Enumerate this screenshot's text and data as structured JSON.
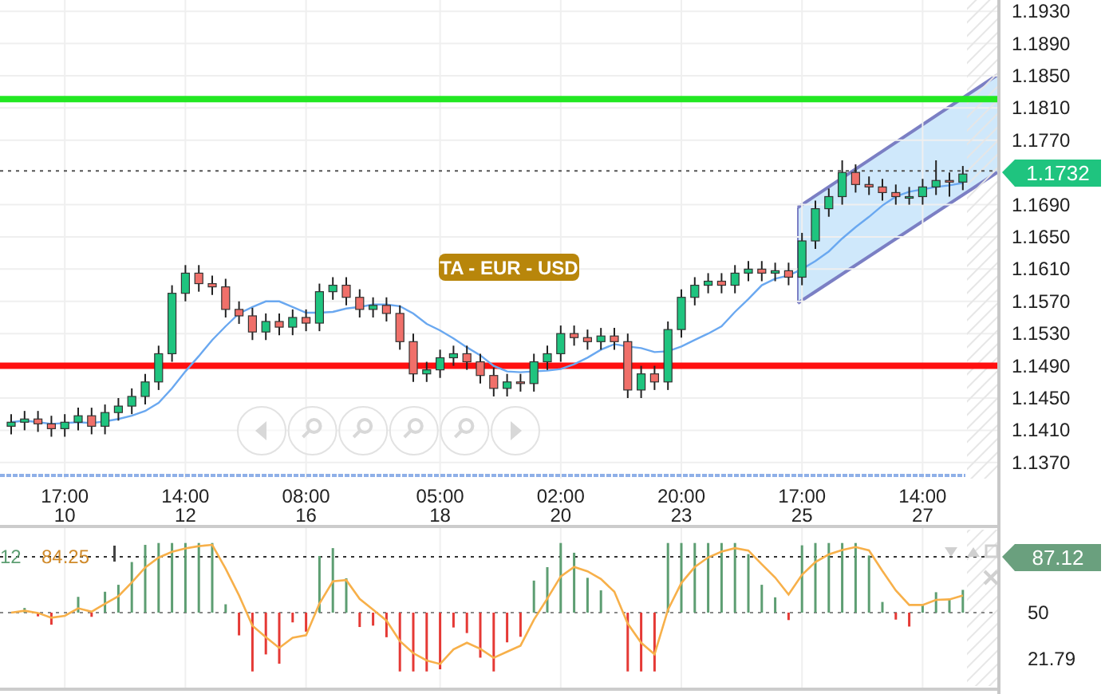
{
  "price_chart": {
    "badge": "TA - EUR - USD",
    "current_price": "1.1732",
    "dates": [
      "10",
      "12",
      "16",
      "18",
      "20",
      "23",
      "25",
      "27"
    ],
    "chart_data": {
      "type": "candlestick",
      "grid": true,
      "ylim": [
        1.135,
        1.1944
      ],
      "categories": [
        null,
        null,
        null,
        null,
        "17:00",
        null,
        null,
        null,
        null,
        null,
        null,
        null,
        null,
        "14:00",
        null,
        null,
        null,
        null,
        null,
        null,
        null,
        null,
        "08:00",
        null,
        null,
        null,
        null,
        null,
        null,
        null,
        null,
        null,
        "05:00",
        null,
        null,
        null,
        null,
        null,
        null,
        null,
        null,
        "02:00",
        null,
        null,
        null,
        null,
        null,
        null,
        null,
        null,
        "20:00",
        null,
        null,
        null,
        null,
        null,
        null,
        null,
        null,
        "17:00",
        null,
        null,
        null,
        null,
        null,
        null,
        null,
        null,
        "14:00",
        null,
        null,
        null
      ],
      "yticks": [
        {
          "value": 1.193,
          "label": "1.1930"
        },
        {
          "value": 1.189,
          "label": "1.1890"
        },
        {
          "value": 1.185,
          "label": "1.1850"
        },
        {
          "value": 1.181,
          "label": "1.1810"
        },
        {
          "value": 1.177,
          "label": "1.1770"
        },
        {
          "value": 1.169,
          "label": "1.1690"
        },
        {
          "value": 1.165,
          "label": "1.1650"
        },
        {
          "value": 1.161,
          "label": "1.1610"
        },
        {
          "value": 1.157,
          "label": "1.1570"
        },
        {
          "value": 1.153,
          "label": "1.1530"
        },
        {
          "value": 1.149,
          "label": "1.1490"
        },
        {
          "value": 1.145,
          "label": "1.1450"
        },
        {
          "value": 1.141,
          "label": "1.1410"
        },
        {
          "value": 1.137,
          "label": "1.1370"
        }
      ],
      "ohlc": [
        [
          1.1415,
          1.143,
          1.1405,
          1.142
        ],
        [
          1.142,
          1.1434,
          1.141,
          1.1424
        ],
        [
          1.1424,
          1.1434,
          1.1408,
          1.1418
        ],
        [
          1.1418,
          1.1428,
          1.1402,
          1.1412
        ],
        [
          1.1412,
          1.143,
          1.1402,
          1.142
        ],
        [
          1.142,
          1.1438,
          1.141,
          1.1428
        ],
        [
          1.1428,
          1.1438,
          1.1405,
          1.1415
        ],
        [
          1.1415,
          1.1442,
          1.1405,
          1.1432
        ],
        [
          1.1432,
          1.145,
          1.1422,
          1.144
        ],
        [
          1.144,
          1.1462,
          1.143,
          1.1452
        ],
        [
          1.1452,
          1.148,
          1.1442,
          1.147
        ],
        [
          1.147,
          1.1515,
          1.146,
          1.1505
        ],
        [
          1.1505,
          1.159,
          1.1495,
          1.158
        ],
        [
          1.158,
          1.1615,
          1.157,
          1.1605
        ],
        [
          1.1605,
          1.1615,
          1.1582,
          1.1592
        ],
        [
          1.1592,
          1.1602,
          1.1578,
          1.1588
        ],
        [
          1.1588,
          1.1598,
          1.155,
          1.156
        ],
        [
          1.156,
          1.157,
          1.1542,
          1.1552
        ],
        [
          1.1552,
          1.1562,
          1.1522,
          1.1532
        ],
        [
          1.1532,
          1.1555,
          1.1522,
          1.1545
        ],
        [
          1.1545,
          1.1555,
          1.1528,
          1.1538
        ],
        [
          1.1538,
          1.156,
          1.1528,
          1.155
        ],
        [
          1.155,
          1.156,
          1.1533,
          1.1543
        ],
        [
          1.1543,
          1.1592,
          1.1533,
          1.1582
        ],
        [
          1.1582,
          1.16,
          1.1572,
          1.159
        ],
        [
          1.159,
          1.16,
          1.1565,
          1.1575
        ],
        [
          1.1575,
          1.1585,
          1.155,
          1.156
        ],
        [
          1.156,
          1.1575,
          1.155,
          1.1565
        ],
        [
          1.1565,
          1.1575,
          1.1545,
          1.1555
        ],
        [
          1.1555,
          1.1565,
          1.151,
          1.152
        ],
        [
          1.152,
          1.153,
          1.147,
          1.148
        ],
        [
          1.148,
          1.1495,
          1.147,
          1.1485
        ],
        [
          1.1485,
          1.151,
          1.1475,
          1.15
        ],
        [
          1.15,
          1.1515,
          1.149,
          1.1505
        ],
        [
          1.1505,
          1.1515,
          1.1485,
          1.1495
        ],
        [
          1.1495,
          1.1505,
          1.1468,
          1.1478
        ],
        [
          1.1478,
          1.1488,
          1.1452,
          1.1462
        ],
        [
          1.1462,
          1.148,
          1.1452,
          1.147
        ],
        [
          1.147,
          1.148,
          1.1458,
          1.1468
        ],
        [
          1.1468,
          1.1505,
          1.1458,
          1.1495
        ],
        [
          1.1495,
          1.1515,
          1.1485,
          1.1505
        ],
        [
          1.1505,
          1.154,
          1.1495,
          1.153
        ],
        [
          1.153,
          1.154,
          1.1515,
          1.1525
        ],
        [
          1.1525,
          1.1535,
          1.151,
          1.152
        ],
        [
          1.152,
          1.1537,
          1.151,
          1.1527
        ],
        [
          1.1527,
          1.1537,
          1.151,
          1.152
        ],
        [
          1.152,
          1.153,
          1.145,
          1.146
        ],
        [
          1.146,
          1.149,
          1.145,
          1.148
        ],
        [
          1.148,
          1.149,
          1.146,
          1.147
        ],
        [
          1.147,
          1.1545,
          1.146,
          1.1535
        ],
        [
          1.1535,
          1.1585,
          1.1525,
          1.1575
        ],
        [
          1.1575,
          1.16,
          1.1565,
          1.159
        ],
        [
          1.159,
          1.1605,
          1.158,
          1.1595
        ],
        [
          1.1595,
          1.1605,
          1.158,
          1.159
        ],
        [
          1.159,
          1.1615,
          1.158,
          1.1605
        ],
        [
          1.1605,
          1.162,
          1.1595,
          1.161
        ],
        [
          1.161,
          1.162,
          1.1595,
          1.1605
        ],
        [
          1.1605,
          1.1618,
          1.1595,
          1.1608
        ],
        [
          1.1608,
          1.1618,
          1.159,
          1.16
        ],
        [
          1.16,
          1.1655,
          1.159,
          1.1645
        ],
        [
          1.1645,
          1.1695,
          1.1635,
          1.1685
        ],
        [
          1.1685,
          1.171,
          1.1675,
          1.17
        ],
        [
          1.17,
          1.1745,
          1.169,
          1.173
        ],
        [
          1.173,
          1.174,
          1.1705,
          1.1715
        ],
        [
          1.1715,
          1.1725,
          1.1702,
          1.1712
        ],
        [
          1.1712,
          1.1722,
          1.1695,
          1.1705
        ],
        [
          1.1705,
          1.1715,
          1.169,
          1.17
        ],
        [
          1.17,
          1.1712,
          1.169,
          1.17
        ],
        [
          1.17,
          1.1722,
          1.169,
          1.1712
        ],
        [
          1.1712,
          1.1745,
          1.1702,
          1.172
        ],
        [
          1.172,
          1.173,
          1.17,
          1.1718
        ],
        [
          1.1718,
          1.1738,
          1.1708,
          1.1728
        ]
      ],
      "series": [
        {
          "type": "line",
          "color": "#6aa8f0",
          "values": [
            1.142,
            1.1422,
            1.142,
            1.1418,
            1.1419,
            1.142,
            1.1419,
            1.1421,
            1.1424,
            1.1428,
            1.1434,
            1.1444,
            1.1462,
            1.1483,
            1.1502,
            1.1522,
            1.1539,
            1.1555,
            1.1563,
            1.157,
            1.157,
            1.1563,
            1.1556,
            1.1556,
            1.1557,
            1.1561,
            1.1563,
            1.1566,
            1.1566,
            1.1564,
            1.1555,
            1.1542,
            1.1534,
            1.1524,
            1.1513,
            1.1503,
            1.149,
            1.1483,
            1.1482,
            1.1483,
            1.1484,
            1.1486,
            1.1492,
            1.15,
            1.151,
            1.1517,
            1.1514,
            1.1512,
            1.1507,
            1.1508,
            1.1514,
            1.1522,
            1.153,
            1.1539,
            1.1557,
            1.1573,
            1.159,
            1.1598,
            1.1602,
            1.161,
            1.162,
            1.1632,
            1.1648,
            1.1662,
            1.1675,
            1.1689,
            1.17,
            1.1706,
            1.1709,
            1.1712,
            1.1714,
            1.1717
          ]
        }
      ],
      "ref_lines": [
        {
          "axis": "y",
          "value": 1.1821,
          "color": "#22e822"
        },
        {
          "axis": "y",
          "value": 1.149,
          "color": "#ff1010"
        },
        {
          "axis": "y",
          "value": 1.1732,
          "color": "#555555"
        }
      ]
    }
  },
  "indicator": {
    "period": "12",
    "value": "84.25",
    "current_value": "87.12",
    "axis_labels": [
      "50",
      "21.79"
    ]
  }
}
